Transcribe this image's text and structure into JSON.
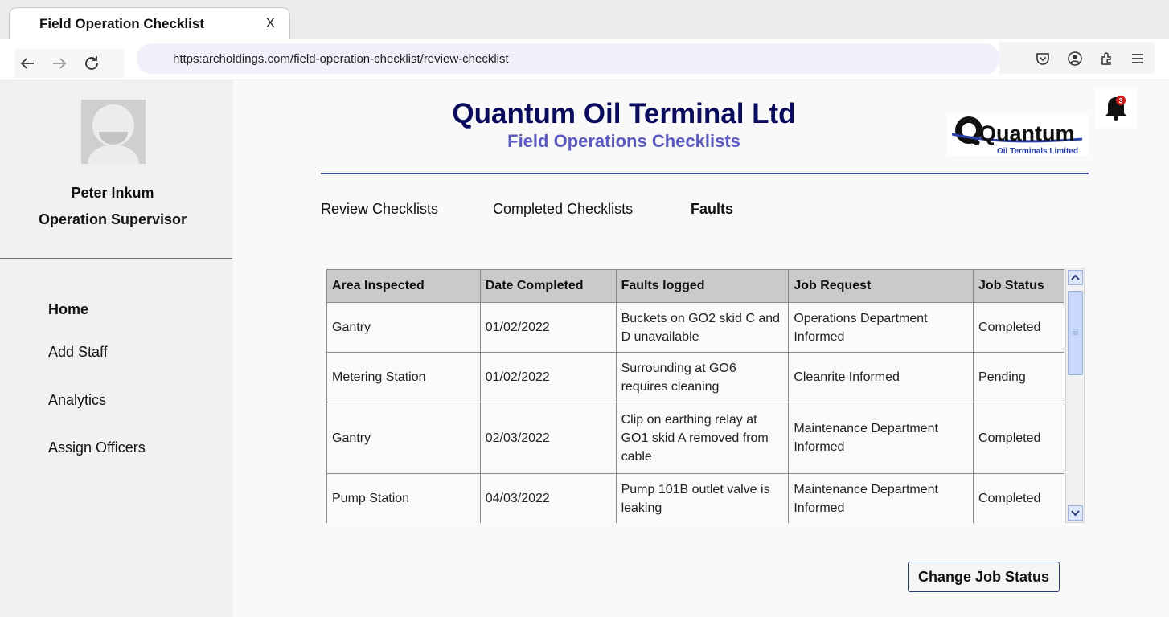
{
  "browser": {
    "tab_title": "Field Operation Checklist",
    "tab_close": "X",
    "url": "https:archoldings.com/field-operation-checklist/review-checklist",
    "notification_count": "3"
  },
  "user": {
    "name": "Peter Inkum",
    "role": "Operation Supervisor"
  },
  "sidebar": {
    "items": [
      {
        "label": "Home",
        "active": true
      },
      {
        "label": "Add Staff"
      },
      {
        "label": "Analytics"
      },
      {
        "label": "Assign Officers"
      }
    ]
  },
  "header": {
    "title": "Quantum Oil Terminal Ltd",
    "subtitle": "Field Operations Checklists",
    "logo_text": "Quantum",
    "logo_subtext": "Oil Terminals Limited"
  },
  "tabs": [
    {
      "label": "Review Checklists"
    },
    {
      "label": "Completed Checklists"
    },
    {
      "label": "Faults",
      "active": true
    }
  ],
  "table": {
    "columns": [
      "Area Inspected",
      "Date Completed",
      "Faults logged",
      "Job Request",
      "Job Status"
    ],
    "rows": [
      [
        "Gantry",
        "01/02/2022",
        "Buckets on GO2 skid C and D unavailable",
        "Operations Department Informed",
        "Completed"
      ],
      [
        "Metering Station",
        "01/02/2022",
        "Surrounding at GO6 requires cleaning",
        "Cleanrite Informed",
        "Pending"
      ],
      [
        "Gantry",
        "02/03/2022",
        "Clip on earthing relay at GO1 skid A removed from cable",
        "Maintenance Department Informed",
        "Completed"
      ],
      [
        "Pump Station",
        "04/03/2022",
        "Pump 101B outlet valve is leaking",
        "Maintenance Department Informed",
        "Completed"
      ]
    ]
  },
  "actions": {
    "change_status": "Change Job Status"
  },
  "colors": {
    "title": "#0b0b5e",
    "subtitle": "#5b5bbf",
    "header_line": "#3b4a9a",
    "table_header": "#cacaca"
  }
}
